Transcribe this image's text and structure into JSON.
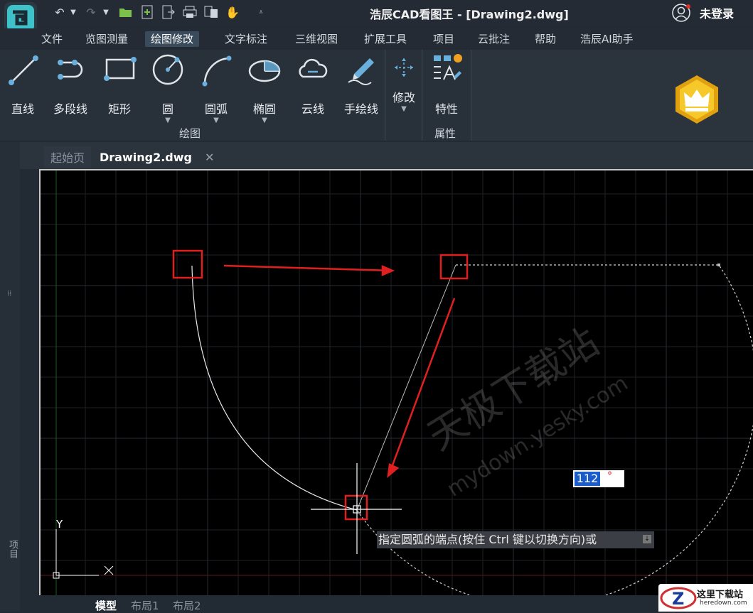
{
  "app": {
    "title": "浩辰CAD看图王 - [Drawing2.dwg]",
    "user_label": "未登录"
  },
  "menu": [
    "文件",
    "览图测量",
    "绘图修改",
    "文字标注",
    "三维视图",
    "扩展工具",
    "项目",
    "云批注",
    "帮助",
    "浩辰AI助手"
  ],
  "menu_active": "绘图修改",
  "ribbon": {
    "draw_tools": [
      {
        "label": "直线",
        "icon": "line-icon",
        "dropdown": false
      },
      {
        "label": "多段线",
        "icon": "polyline-icon",
        "dropdown": false
      },
      {
        "label": "矩形",
        "icon": "rectangle-icon",
        "dropdown": false
      },
      {
        "label": "圆",
        "icon": "circle-icon",
        "dropdown": true
      },
      {
        "label": "圆弧",
        "icon": "arc-icon",
        "dropdown": true
      },
      {
        "label": "椭圆",
        "icon": "ellipse-icon",
        "dropdown": true
      },
      {
        "label": "云线",
        "icon": "cloud-icon",
        "dropdown": false
      },
      {
        "label": "手绘线",
        "icon": "pen-icon",
        "dropdown": false
      }
    ],
    "draw_group_label": "绘图",
    "modify_label": "修改",
    "properties_tool_label": "特性",
    "properties_group_label": "属性"
  },
  "left_panel_label": "项目",
  "tabs": [
    {
      "label": "起始页",
      "active": false
    },
    {
      "label": "Drawing2.dwg",
      "active": true
    }
  ],
  "layout_tabs": [
    {
      "label": "模型",
      "active": true
    },
    {
      "label": "布局1",
      "active": false
    },
    {
      "label": "布局2",
      "active": false
    }
  ],
  "canvas": {
    "angle_input_value": "112",
    "angle_unit": "°",
    "command_prompt": "指定圆弧的端点(按住 Ctrl 键以切换方向)或",
    "ucs_y_label": "Y",
    "watermark_text": "天极下载站",
    "watermark_url": "mydown.yesky.com"
  },
  "corner_watermark": {
    "title": "这里下载站",
    "url": "heredown.com"
  },
  "colors": {
    "accent_active_tab": "#3a4b5c",
    "annotation_red": "#e02020",
    "input_selection": "#1a5ccc",
    "tool_icon_blue": "#6ab0dc"
  }
}
